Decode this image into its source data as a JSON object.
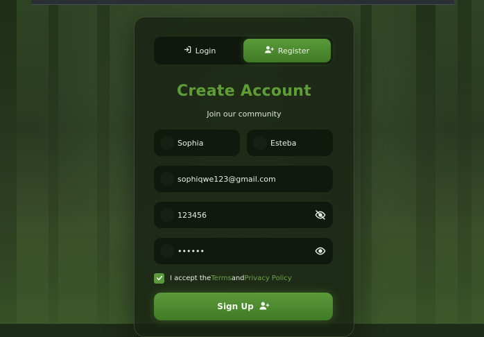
{
  "tabs": {
    "login_label": "Login",
    "register_label": "Register",
    "active": "Register"
  },
  "heading": {
    "title": "Create Account",
    "subtitle": "Join our community"
  },
  "form": {
    "first_name": "Sophia",
    "last_name": "Esteba",
    "email": "sophiqwe123@gmail.com",
    "password": "123456",
    "confirm_password_masked": "••••••",
    "password_visibility_icon": "eye-off-icon",
    "confirm_visibility_icon": "eye-icon"
  },
  "terms": {
    "checked": true,
    "prefix": "I accept the",
    "terms_link": "Terms",
    "conjunction": "and",
    "privacy_link": "Privacy Policy"
  },
  "submit": {
    "label": "Sign Up"
  },
  "colors": {
    "accent": "#5a9a3a",
    "title": "#5f9e37",
    "card_bg": "#18220f",
    "field_bg": "#0e140c"
  }
}
